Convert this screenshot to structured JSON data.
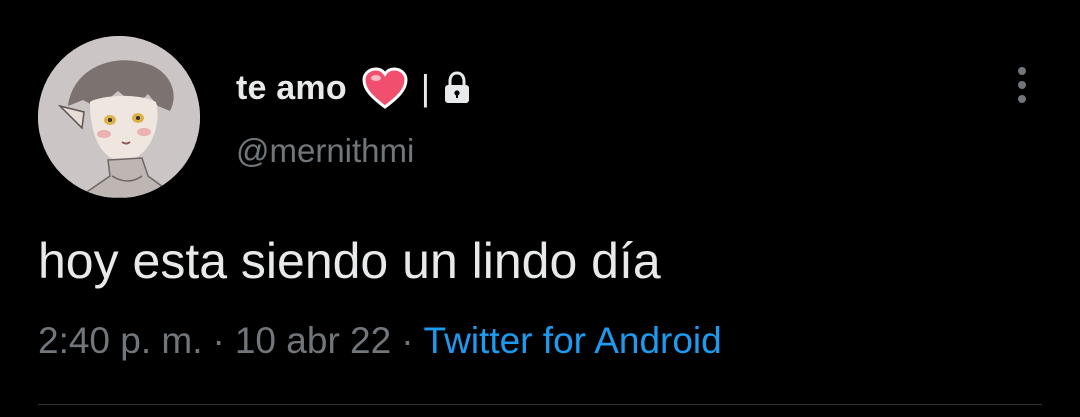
{
  "user": {
    "display_name": "te amo",
    "separator": "|",
    "handle": "@mernithmi",
    "heart_icon": "heart-emoji-icon",
    "lock_icon": "lock-icon"
  },
  "tweet": {
    "text": "hoy esta siendo un lindo día",
    "time": "2:40 p. m.",
    "date": "10 abr 22",
    "separator": "·",
    "source": "Twitter for Android"
  },
  "colors": {
    "background": "#000000",
    "primary_text": "#e7e9ea",
    "secondary_text": "#71767b",
    "link": "#1d9bf0",
    "heart": "#f0506e",
    "divider": "#2f3336"
  }
}
